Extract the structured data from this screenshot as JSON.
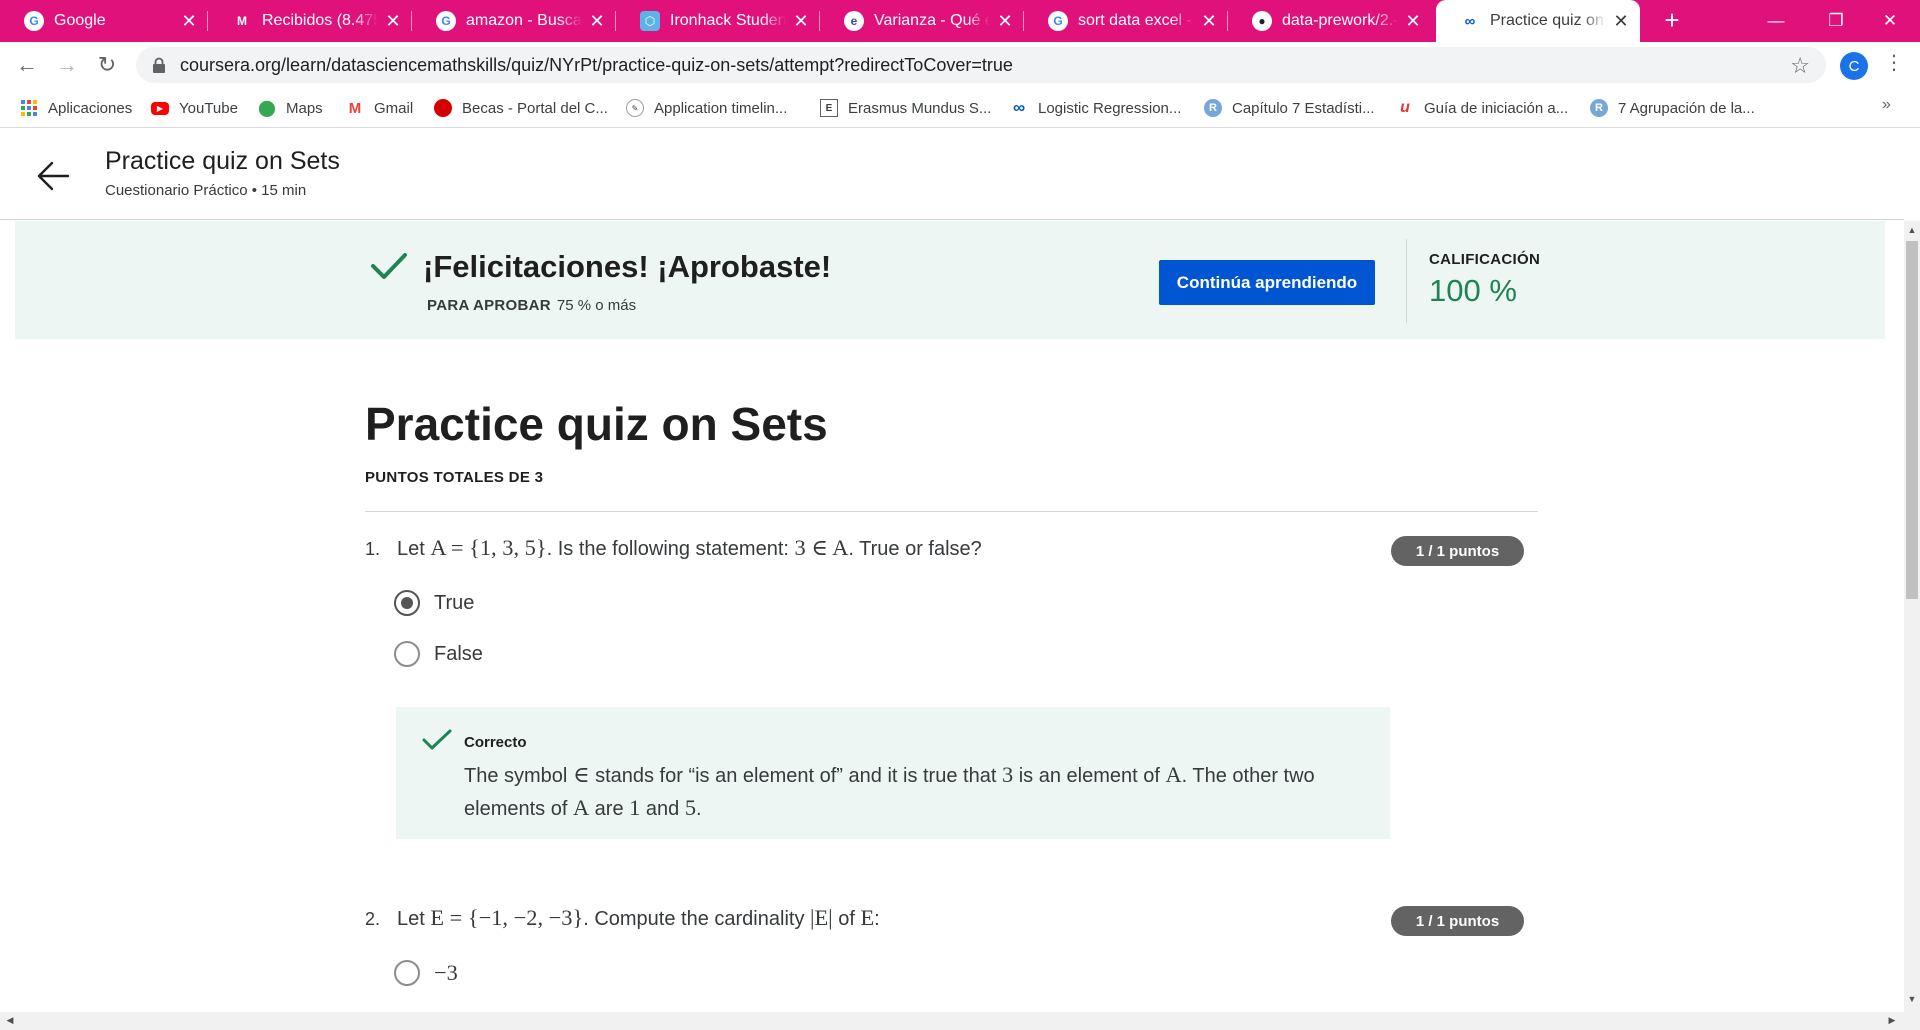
{
  "tabs": [
    {
      "title": "Google",
      "favicon": "google-icon",
      "active": false
    },
    {
      "title": "Recibidos (8.475) - ",
      "favicon": "gmail-icon",
      "active": false
    },
    {
      "title": "amazon - Buscar c",
      "favicon": "google-icon",
      "active": false
    },
    {
      "title": "Ironhack Student P",
      "favicon": "ironhack-icon",
      "active": false
    },
    {
      "title": "Varianza - Qué es,",
      "favicon": "economipedia-icon",
      "active": false
    },
    {
      "title": "sort data excel - Bu",
      "favicon": "google-icon",
      "active": false
    },
    {
      "title": "data-prework/2.-St",
      "favicon": "github-icon",
      "active": false
    },
    {
      "title": "Practice quiz on Se",
      "favicon": "coursera-icon",
      "active": true
    }
  ],
  "browser": {
    "url": "coursera.org/learn/datasciencemathskills/quiz/NYrPt/practice-quiz-on-sets/attempt?redirectToCover=true",
    "profile_initial": "C"
  },
  "bookmarks": [
    {
      "label": "Aplicaciones",
      "icon": "apps-grid-icon"
    },
    {
      "label": "YouTube",
      "icon": "youtube-icon"
    },
    {
      "label": "Maps",
      "icon": "maps-icon"
    },
    {
      "label": "Gmail",
      "icon": "gmail-icon"
    },
    {
      "label": "Becas - Portal del C...",
      "icon": "red-dot-icon"
    },
    {
      "label": "Application timelin...",
      "icon": "document-icon"
    },
    {
      "label": "Erasmus Mundus S...",
      "icon": "erasmus-icon"
    },
    {
      "label": "Logistic Regression...",
      "icon": "coursera-icon"
    },
    {
      "label": "Capítulo 7 Estadísti...",
      "icon": "r-icon"
    },
    {
      "label": "Guía de iniciación a...",
      "icon": "u-icon"
    },
    {
      "label": "7 Agrupación de la...",
      "icon": "r-icon"
    }
  ],
  "header": {
    "title": "Practice quiz on Sets",
    "subtitle": "Cuestionario Práctico • 15 min"
  },
  "banner": {
    "title": "¡Felicitaciones! ¡Aprobaste!",
    "pass_label": "PARA APROBAR",
    "pass_value": "75 % o más",
    "button": "Continúa aprendiendo",
    "grade_label": "CALIFICACIÓN",
    "grade_value": "100 %"
  },
  "quiz": {
    "title": "Practice quiz on Sets",
    "points_label": "PUNTOS TOTALES DE 3",
    "questions": [
      {
        "number": "1.",
        "parts": [
          "Let ",
          "A = {1, 3, 5}",
          ". Is the following statement: ",
          "3 ∈ A",
          ". True or false?"
        ],
        "badge": "1 / 1 puntos",
        "options": [
          {
            "label": "True",
            "selected": true
          },
          {
            "label": "False",
            "selected": false
          }
        ],
        "feedback": {
          "label": "Correcto",
          "parts": [
            "The symbol ",
            "∈",
            " stands for “is an element of” and it is true that ",
            "3",
            " is an element of ",
            "A",
            ". The other two elements of ",
            "A",
            " are ",
            "1",
            " and ",
            "5",
            "."
          ]
        }
      },
      {
        "number": "2.",
        "parts": [
          "Let ",
          "E = {−1, −2, −3}",
          ". Compute the cardinality ",
          "|E|",
          " of ",
          "E",
          ":"
        ],
        "badge": "1 / 1 puntos",
        "options": [
          {
            "label": "−3",
            "selected": false
          }
        ]
      }
    ]
  },
  "colors": {
    "tab_strip": "#e0117a",
    "primary_button": "#0056d2",
    "success": "#1f8354",
    "banner_bg": "#eef6f4"
  }
}
